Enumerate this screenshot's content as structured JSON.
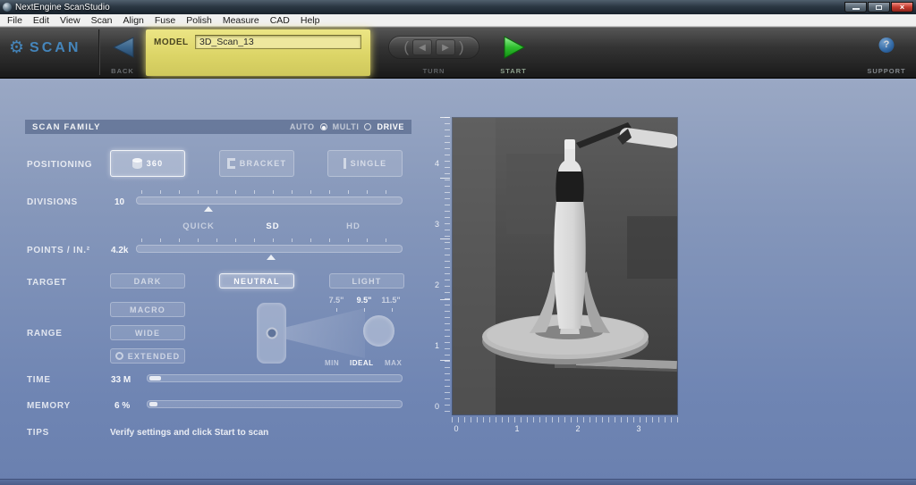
{
  "window": {
    "title": "NextEngine ScanStudio"
  },
  "menu": {
    "items": [
      "File",
      "Edit",
      "View",
      "Scan",
      "Align",
      "Fuse",
      "Polish",
      "Measure",
      "CAD",
      "Help"
    ]
  },
  "icons": {
    "gear": "⚙",
    "close": "×",
    "turn_left": "◀",
    "turn_right": "▶",
    "paren_left": "(",
    "paren_right": ")",
    "question": "?"
  },
  "colors": {
    "highlight_yellow": "#dcd567",
    "start_green": "#2fbf2f",
    "scan_blue": "#4aa0e8"
  },
  "toolbar": {
    "logo_text": "SCAN",
    "back_label": "BACK",
    "model_label": "MODEL",
    "model_value": "3D_Scan_13",
    "turn_label": "TURN",
    "start_label": "START",
    "support_label": "SUPPORT"
  },
  "settings": {
    "scan_family_label": "SCAN FAMILY",
    "modes": {
      "auto": "AUTO",
      "multi": "MULTI",
      "drive": "DRIVE"
    },
    "positioning_label": "POSITIONING",
    "positioning_buttons": {
      "b360": "360",
      "bracket": "BRACKET",
      "single": "SINGLE"
    },
    "divisions_label": "DIVISIONS",
    "divisions_value": "10",
    "quality": {
      "quick": "QUICK",
      "sd": "SD",
      "hd": "HD"
    },
    "points_label": "POINTS / IN.²",
    "points_value": "4.2k",
    "target_label": "TARGET",
    "target_buttons": {
      "dark": "DARK",
      "neutral": "NEUTRAL",
      "light": "LIGHT"
    },
    "macro_label": "MACRO",
    "range_label": "RANGE",
    "wide_label": "WIDE",
    "extended_label": "EXTENDED",
    "distances": {
      "d1": "7.5\"",
      "d2": "9.5\"",
      "d3": "11.5\""
    },
    "range_markers": {
      "min": "MIN",
      "ideal": "IDEAL",
      "max": "MAX"
    },
    "time_label": "TIME",
    "time_value": "33 M",
    "memory_label": "MEMORY",
    "memory_value": "6 %",
    "tips_label": "TIPS",
    "tips_text": "Verify settings and click Start to scan"
  },
  "preview": {
    "v_ruler": [
      "4",
      "3",
      "2",
      "1",
      "0"
    ],
    "h_ruler": [
      "0",
      "1",
      "2",
      "3"
    ]
  }
}
